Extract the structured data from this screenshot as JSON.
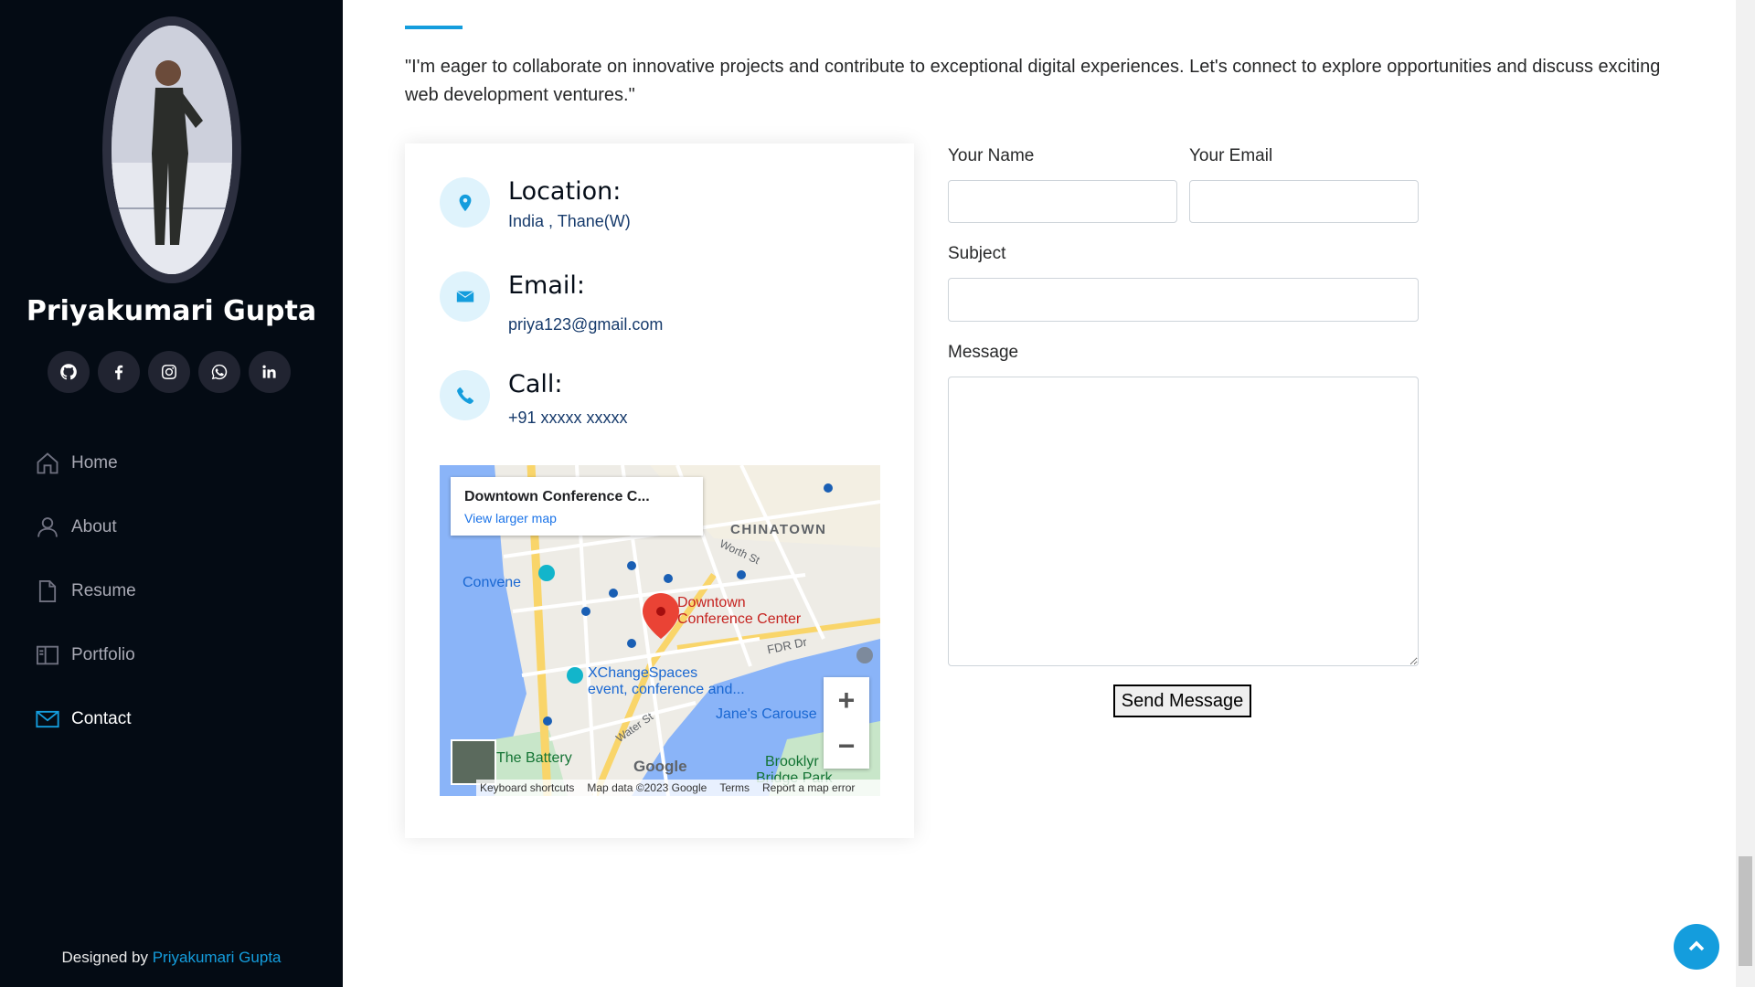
{
  "profile": {
    "name": "Priyakumari Gupta"
  },
  "social": [
    {
      "icon": "github-icon"
    },
    {
      "icon": "facebook-icon"
    },
    {
      "icon": "instagram-icon"
    },
    {
      "icon": "whatsapp-icon"
    },
    {
      "icon": "linkedin-icon"
    }
  ],
  "nav": {
    "items": [
      {
        "label": "Home",
        "icon": "home-icon"
      },
      {
        "label": "About",
        "icon": "person-icon"
      },
      {
        "label": "Resume",
        "icon": "file-icon"
      },
      {
        "label": "Portfolio",
        "icon": "book-icon"
      },
      {
        "label": "Contact",
        "icon": "envelope-icon",
        "active": true
      }
    ]
  },
  "footer": {
    "prefix": "Designed by ",
    "author": "Priyakumari Gupta"
  },
  "contact": {
    "intro": "\"I'm eager to collaborate on innovative projects and contribute to exceptional digital experiences. Let's connect to explore opportunities and discuss exciting web development ventures.\"",
    "location": {
      "title": "Location:",
      "value": "India , Thane(W)"
    },
    "email": {
      "title": "Email:",
      "value": "priya123@gmail.com"
    },
    "call": {
      "title": "Call:",
      "value": "+91 xxxxx xxxxx"
    }
  },
  "map": {
    "card_title": "Downtown Conference C...",
    "card_link": "View larger map",
    "labels": {
      "chinatown": "CHINATOWN",
      "worth_st": "Worth St",
      "convene": "Convene",
      "downtown": "Downtown",
      "conference_center": "Conference Center",
      "fdr_dr": "FDR Dr",
      "xchange_1": "XChangeSpaces",
      "xchange_2": "event, conference and...",
      "water_st": "Water St",
      "janes_carousel": "Jane's Carouse",
      "the_battery": "The Battery",
      "google": "Google",
      "brooklyn": "Brooklyr",
      "bridge_park": "Bridge Park"
    },
    "zoom_in": "+",
    "zoom_out": "−",
    "footer": {
      "shortcuts": "Keyboard shortcuts",
      "data": "Map data ©2023 Google",
      "terms": "Terms",
      "report": "Report a map error"
    }
  },
  "form": {
    "name_label": "Your Name",
    "email_label": "Your Email",
    "subject_label": "Subject",
    "message_label": "Message",
    "name_value": "",
    "email_value": "",
    "subject_value": "",
    "message_value": "",
    "submit_label": "Send Message"
  },
  "colors": {
    "accent": "#149ddd",
    "sidebar_bg": "#040b14"
  }
}
